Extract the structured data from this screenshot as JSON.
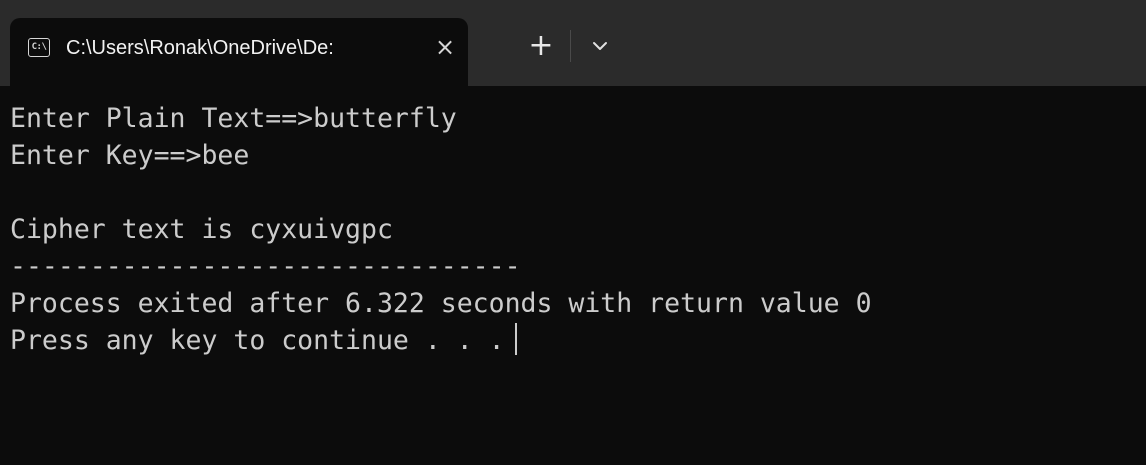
{
  "window": {
    "tab_title": "C:\\Users\\Ronak\\OneDrive\\De:",
    "tab_icon": "console-icon",
    "tab_icon_text": "C:\\",
    "close_glyph": "×",
    "new_tab_glyph": "+",
    "dropdown_icon": "chevron-down-icon"
  },
  "console": {
    "lines": [
      "Enter Plain Text==>butterfly",
      "Enter Key==>bee",
      "",
      "Cipher text is cyxuivgpc",
      "--------------------------------",
      "Process exited after 6.322 seconds with return value 0",
      "Press any key to continue . . ."
    ]
  },
  "colors": {
    "background": "#0c0c0c",
    "titlebar": "#2b2b2b",
    "text": "#cccccc"
  }
}
